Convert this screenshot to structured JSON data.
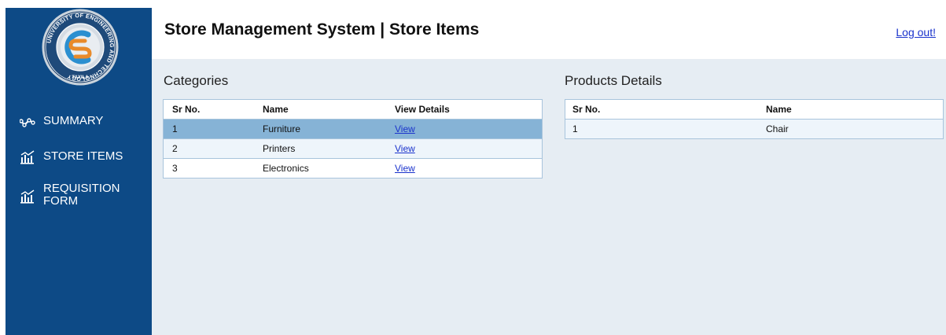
{
  "app": {
    "title": "Store Management System | Store Items",
    "logout_label": "Log out!"
  },
  "logo": {
    "ring_text": "UNIVERSITY OF ENGINEERING AND TECHNOLOGY",
    "city": "TAXILA",
    "letters": "CS"
  },
  "sidebar": {
    "items": [
      {
        "label": "SUMMARY",
        "icon": "trend-line-icon"
      },
      {
        "label": "STORE ITEMS",
        "icon": "bar-chart-icon"
      },
      {
        "label": "REQUISITION FORM",
        "icon": "bar-chart-icon"
      }
    ]
  },
  "categories": {
    "title": "Categories",
    "headers": [
      "Sr No.",
      "Name",
      "View Details"
    ],
    "rows": [
      {
        "sr": "1",
        "name": "Furniture",
        "link": "View",
        "selected": true
      },
      {
        "sr": "2",
        "name": "Printers",
        "link": "View",
        "selected": false
      },
      {
        "sr": "3",
        "name": "Electronics",
        "link": "View",
        "selected": false
      }
    ]
  },
  "products": {
    "title": "Products Details",
    "headers": [
      "Sr No.",
      "Name"
    ],
    "rows": [
      {
        "sr": "1",
        "name": "Chair"
      }
    ]
  },
  "colors": {
    "sidebar": "#0d4a86",
    "main_bg": "#e6edf3",
    "selected_row": "#86b3d6",
    "link": "#1a33cc"
  }
}
